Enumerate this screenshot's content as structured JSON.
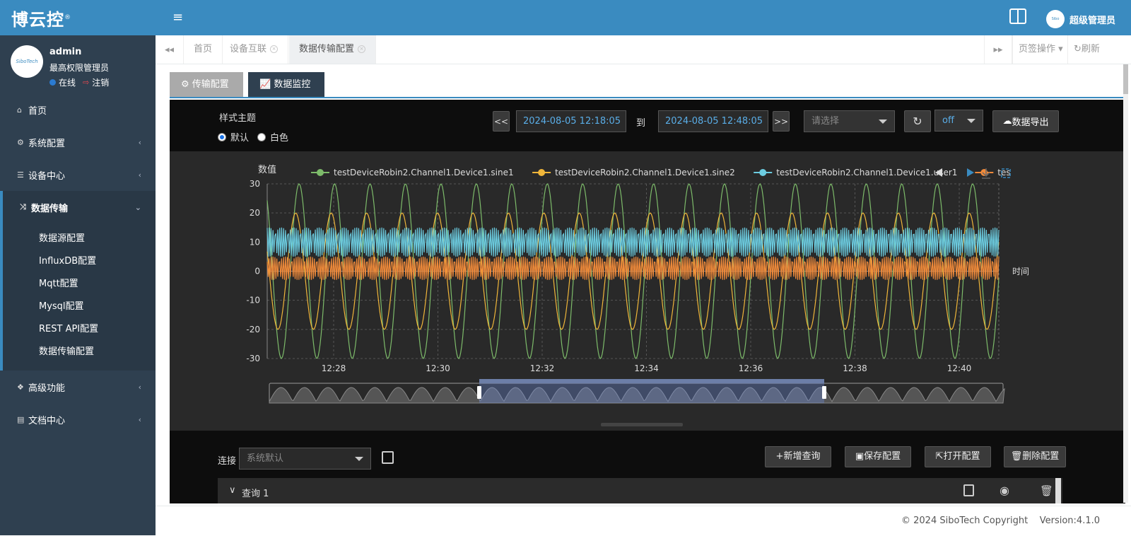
{
  "app": {
    "logo": "博云控",
    "logo_mark": "®"
  },
  "profile": {
    "avatar_text": "SiboTech",
    "name": "admin",
    "role": "最高权限管理员",
    "status": "在线",
    "logout": "注销"
  },
  "sidebar": {
    "items": [
      {
        "label": "首页",
        "icon": "home-icon"
      },
      {
        "label": "系统配置",
        "icon": "gear-icon"
      },
      {
        "label": "设备中心",
        "icon": "server-icon"
      },
      {
        "label": "数据传输",
        "icon": "shuffle-icon"
      },
      {
        "label": "高级功能",
        "icon": "cubes-icon"
      },
      {
        "label": "文档中心",
        "icon": "file-icon"
      }
    ],
    "subitems": [
      "数据源配置",
      "InfluxDB配置",
      "Mqtt配置",
      "Mysql配置",
      "REST API配置",
      "数据传输配置"
    ]
  },
  "topbar": {
    "user_name": "超级管理员"
  },
  "page_tabs": [
    {
      "label": "首页"
    },
    {
      "label": "设备互联"
    },
    {
      "label": "数据传输配置"
    }
  ],
  "tabbar_right": {
    "page_ops": "页签操作",
    "refresh": "刷新"
  },
  "content_tabs": {
    "config": "传输配置",
    "monitor": "数据监控"
  },
  "filters": {
    "theme_label": "样式主题",
    "theme_default": "默认",
    "theme_white": "白色",
    "prev": "<<",
    "next": ">>",
    "start": "2024-08-05 12:18:05",
    "to": "到",
    "end": "2024-08-05 12:48:05",
    "select_placeholder": "请选择",
    "refresh_value": "off",
    "export": "数据导出"
  },
  "chart_data": {
    "type": "line",
    "ylabel": "数值",
    "xlabel": "时间",
    "ylim": [
      -30,
      30
    ],
    "yticks": [
      30,
      20,
      10,
      0,
      -10,
      -20,
      -30
    ],
    "xticks": [
      "12:28",
      "12:30",
      "12:32",
      "12:34",
      "12:36",
      "12:38",
      "12:40"
    ],
    "legend": "top",
    "grid": true,
    "series": [
      {
        "name": "testDeviceRobin2.Channel1.Device1.sine1",
        "color": "#7dbb6a",
        "amplitude": 30,
        "period_min": 0.68
      },
      {
        "name": "testDeviceRobin2.Channel1.Device1.sine2",
        "color": "#f0b63a",
        "amplitude": 20,
        "period_min": 0.68
      },
      {
        "name": "testDeviceRobin2.Channel1.Device1.user1",
        "color": "#6ccce0",
        "min": 5,
        "max": 15
      },
      {
        "name": "tes",
        "color": "#f08a3a",
        "min": -3,
        "max": 5
      }
    ]
  },
  "query_panel": {
    "conn_label": "连接",
    "conn_placeholder": "系统默认",
    "add": "新增查询",
    "save": "保存配置",
    "open": "打开配置",
    "delete": "删除配置",
    "query_title": "查询 1"
  },
  "footer": {
    "copyright": "© 2024 SiboTech Copyright",
    "version": "Version:4.1.0"
  }
}
